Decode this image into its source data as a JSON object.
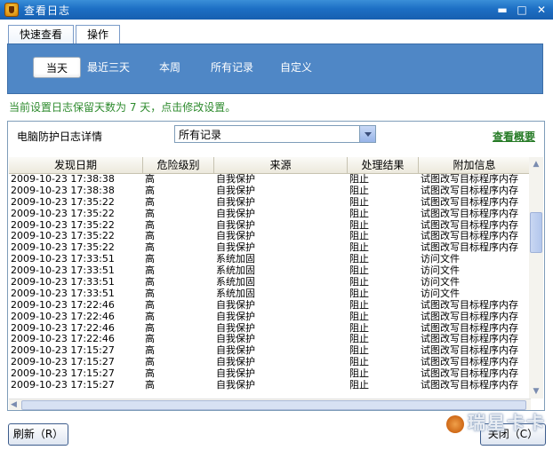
{
  "window": {
    "title": "查看日志",
    "btn_min": "▬",
    "btn_max": "□",
    "btn_close": "✕"
  },
  "tabs": [
    {
      "label": "快速查看",
      "active": true
    },
    {
      "label": "操作",
      "active": false
    }
  ],
  "filters": [
    {
      "label": "当天",
      "active": true
    },
    {
      "label": "最近三天",
      "active": false
    },
    {
      "label": "本周",
      "active": false
    },
    {
      "label": "所有记录",
      "active": false
    },
    {
      "label": "自定义",
      "active": false
    }
  ],
  "notice": "当前设置日志保留天数为 7 天，点击修改设置。",
  "detail": {
    "label": "电脑防护日志详情",
    "select_value": "所有记录",
    "summary_link": "查看概要"
  },
  "table": {
    "headers": [
      "发现日期",
      "危险级别",
      "来源",
      "处理结果",
      "附加信息"
    ],
    "rows": [
      [
        "2009-10-23 17:38:38",
        "高",
        "自我保护",
        "阻止",
        "试图改写目标程序内存"
      ],
      [
        "2009-10-23 17:38:38",
        "高",
        "自我保护",
        "阻止",
        "试图改写目标程序内存"
      ],
      [
        "2009-10-23 17:35:22",
        "高",
        "自我保护",
        "阻止",
        "试图改写目标程序内存"
      ],
      [
        "2009-10-23 17:35:22",
        "高",
        "自我保护",
        "阻止",
        "试图改写目标程序内存"
      ],
      [
        "2009-10-23 17:35:22",
        "高",
        "自我保护",
        "阻止",
        "试图改写目标程序内存"
      ],
      [
        "2009-10-23 17:35:22",
        "高",
        "自我保护",
        "阻止",
        "试图改写目标程序内存"
      ],
      [
        "2009-10-23 17:35:22",
        "高",
        "自我保护",
        "阻止",
        "试图改写目标程序内存"
      ],
      [
        "2009-10-23 17:33:51",
        "高",
        "系统加固",
        "阻止",
        "访问文件"
      ],
      [
        "2009-10-23 17:33:51",
        "高",
        "系统加固",
        "阻止",
        "访问文件"
      ],
      [
        "2009-10-23 17:33:51",
        "高",
        "系统加固",
        "阻止",
        "访问文件"
      ],
      [
        "2009-10-23 17:33:51",
        "高",
        "系统加固",
        "阻止",
        "访问文件"
      ],
      [
        "2009-10-23 17:22:46",
        "高",
        "自我保护",
        "阻止",
        "试图改写目标程序内存"
      ],
      [
        "2009-10-23 17:22:46",
        "高",
        "自我保护",
        "阻止",
        "试图改写目标程序内存"
      ],
      [
        "2009-10-23 17:22:46",
        "高",
        "自我保护",
        "阻止",
        "试图改写目标程序内存"
      ],
      [
        "2009-10-23 17:22:46",
        "高",
        "自我保护",
        "阻止",
        "试图改写目标程序内存"
      ],
      [
        "2009-10-23 17:15:27",
        "高",
        "自我保护",
        "阻止",
        "试图改写目标程序内存"
      ],
      [
        "2009-10-23 17:15:27",
        "高",
        "自我保护",
        "阻止",
        "试图改写目标程序内存"
      ],
      [
        "2009-10-23 17:15:27",
        "高",
        "自我保护",
        "阻止",
        "试图改写目标程序内存"
      ],
      [
        "2009-10-23 17:15:27",
        "高",
        "自我保护",
        "阻止",
        "试图改写目标程序内存"
      ]
    ]
  },
  "buttons": {
    "refresh": "刷新（R）",
    "close": "关闭（C）"
  },
  "watermark": "瑞星卡卡"
}
